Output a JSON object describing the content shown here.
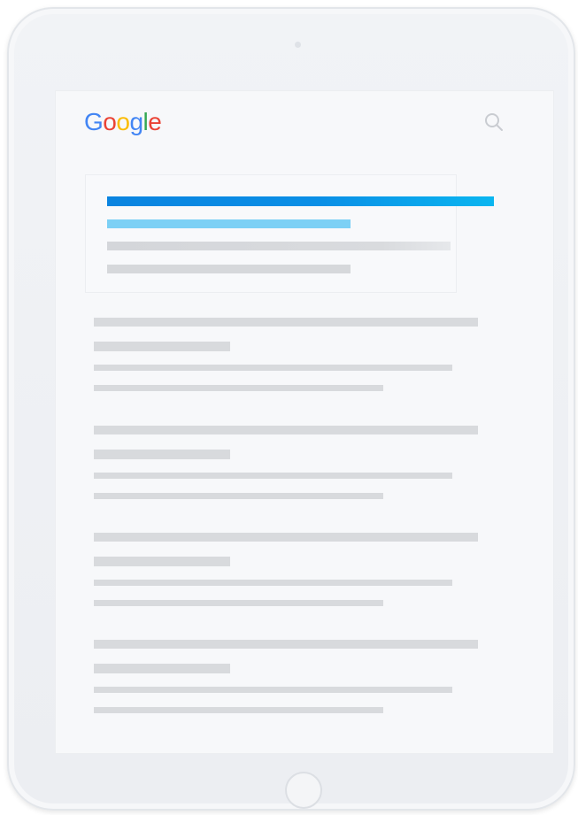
{
  "brand": {
    "name": "Google",
    "letters": [
      {
        "ch": "G",
        "color": "#4285F4"
      },
      {
        "ch": "o",
        "color": "#EA4335"
      },
      {
        "ch": "o",
        "color": "#FBBC05"
      },
      {
        "ch": "g",
        "color": "#4285F4"
      },
      {
        "ch": "l",
        "color": "#34A853"
      },
      {
        "ch": "e",
        "color": "#EA4335"
      }
    ]
  },
  "search": {
    "icon": "search-icon"
  },
  "colors": {
    "title_blue": "#0a8fe6",
    "title_blue_light": "#0ab4ef",
    "url_light_blue": "#7cd0f5",
    "placeholder_gray": "#d6d8db",
    "icon_gray": "#c9ccd1"
  },
  "featured_result": {
    "state": "highlighted"
  },
  "results": [
    {
      "state": "placeholder"
    },
    {
      "state": "placeholder"
    },
    {
      "state": "placeholder"
    },
    {
      "state": "placeholder"
    }
  ]
}
